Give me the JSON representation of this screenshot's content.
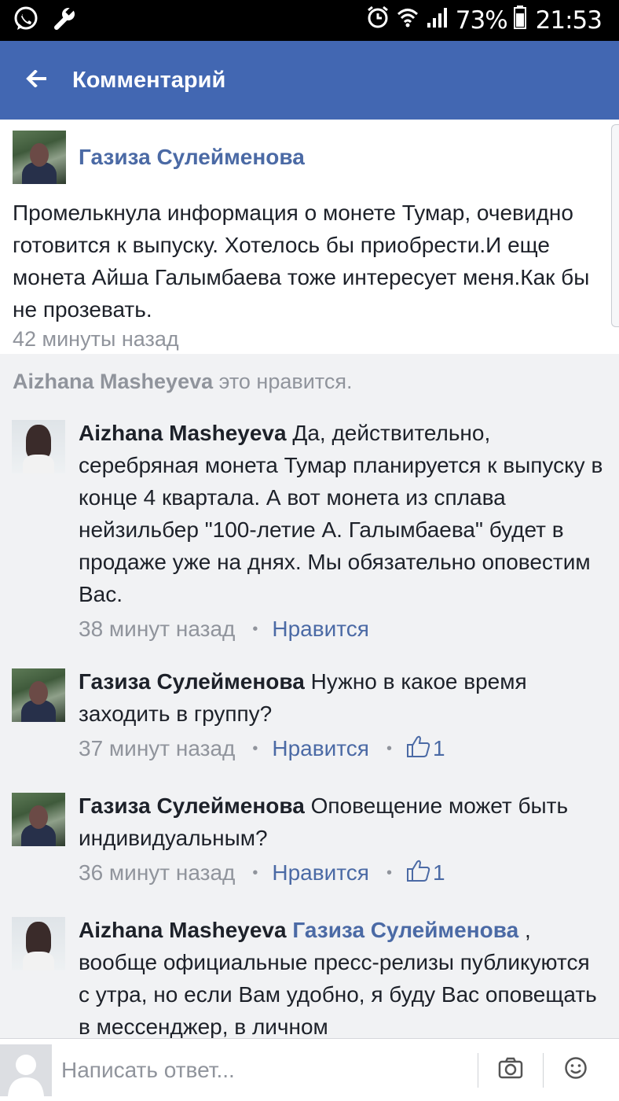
{
  "status_bar": {
    "battery_percent": "73%",
    "time": "21:53",
    "icons": [
      "whatsapp-icon",
      "wrench-icon",
      "alarm-icon",
      "wifi-icon",
      "signal-icon",
      "battery-icon"
    ]
  },
  "header": {
    "title": "Комментарий",
    "back_icon": "back-arrow-icon",
    "background": "#4267b2"
  },
  "post": {
    "author": "Газиза Сулейменова",
    "text": "Промелькнула информация о монете Тумар, очевидно готовится к выпуску. Хотелось бы приобрести.И еще монета  Айша Галымбаева тоже интересует меня.Как бы не прозевать.",
    "time": "42 минуты назад"
  },
  "likes_line": {
    "name": "Aizhana Masheyeva",
    "suffix": "это нравится."
  },
  "comments": [
    {
      "author": "Aizhana Masheyeva",
      "text": "Да, действительно, серебряная монета Тумар планируется к выпуску в конце 4 квартала. А вот монета из сплава нейзильбер \"100-летие А. Галымбаева\" будет в продаже уже на днях. Мы обязательно оповестим Вас.",
      "time": "38 минут назад",
      "like_label": "Нравится"
    },
    {
      "author": "Газиза Сулейменова",
      "text": "Нужно в какое время заходить в группу?",
      "time": "37 минут назад",
      "like_label": "Нравится",
      "like_count": "1"
    },
    {
      "author": "Газиза Сулейменова",
      "text": "Оповещение может быть индивидуальным?",
      "time": "36 минут назад",
      "like_label": "Нравится",
      "like_count": "1"
    },
    {
      "author": "Aizhana Masheyeva",
      "mention": "Газиза Сулейменова",
      "text": ", вообще официальные пресс-релизы публикуются с утра, но если Вам удобно, я буду Вас оповещать в мессенджер, в личном"
    }
  ],
  "composer": {
    "placeholder": "Написать ответ...",
    "camera_icon": "camera-icon",
    "emoji_icon": "emoji-icon"
  },
  "colors": {
    "link": "#4b6aa5",
    "meta_gray": "#90949c",
    "comments_bg": "#f1f2f4"
  }
}
